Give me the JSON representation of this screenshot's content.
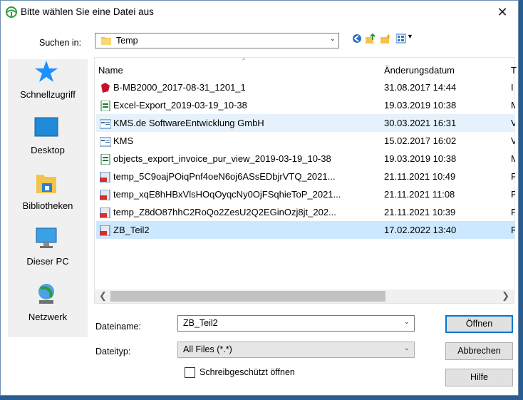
{
  "window": {
    "title": "Bitte wählen Sie eine Datei aus",
    "close_glyph": "✕"
  },
  "lookin": {
    "label": "Suchen in:",
    "value": "Temp"
  },
  "toolbar": {
    "icons": [
      "back-icon",
      "up-folder-icon",
      "new-folder-icon",
      "view-menu-icon"
    ]
  },
  "places": [
    {
      "label": "Schnellzugriff",
      "icon": "quick-access-star-icon"
    },
    {
      "label": "Desktop",
      "icon": "desktop-icon"
    },
    {
      "label": "Bibliotheken",
      "icon": "libraries-icon"
    },
    {
      "label": "Dieser PC",
      "icon": "this-pc-icon"
    },
    {
      "label": "Netzwerk",
      "icon": "network-icon"
    }
  ],
  "filelist": {
    "columns": {
      "name": "Name",
      "date": "Änderungsdatum",
      "type": "T"
    },
    "rows": [
      {
        "name": "B-MB2000_2017-08-31_1201_1",
        "date": "31.08.2017 14:44",
        "type": "I",
        "icon": "red-app-icon"
      },
      {
        "name": "Excel-Export_2019-03-19_10-38",
        "date": "19.03.2019 10:38",
        "type": "M",
        "icon": "excel-file-icon"
      },
      {
        "name": "KMS.de SoftwareEntwicklung GmbH",
        "date": "30.03.2021 16:31",
        "type": "V",
        "icon": "shortcut-file-icon"
      },
      {
        "name": "KMS",
        "date": "15.02.2017 16:02",
        "type": "V",
        "icon": "shortcut-file-icon"
      },
      {
        "name": "objects_export_invoice_pur_view_2019-03-19_10-38",
        "date": "19.03.2019 10:38",
        "type": "M",
        "icon": "excel-file-icon"
      },
      {
        "name": "temp_5C9oajPOiqPnf4oeN6oj6ASsEDbjrVTQ_2021...",
        "date": "21.11.2021 10:49",
        "type": "P",
        "icon": "pdf-file-icon"
      },
      {
        "name": "temp_xqE8hHBxVlsHOqOyqcNy0OjFSqhieToP_2021...",
        "date": "21.11.2021 11:08",
        "type": "P",
        "icon": "pdf-file-icon"
      },
      {
        "name": "temp_Z8dO87hhC2RoQo2ZesU2Q2EGinOzj8jt_202...",
        "date": "21.11.2021 10:39",
        "type": "P",
        "icon": "pdf-file-icon"
      },
      {
        "name": "ZB_Teil2",
        "date": "17.02.2022 13:40",
        "type": "P",
        "icon": "pdf-file-icon"
      }
    ],
    "hovered_row": 2,
    "selected_row": 8
  },
  "filename": {
    "label": "Dateiname:",
    "value": "ZB_Teil2"
  },
  "filetype": {
    "label": "Dateityp:",
    "value": "All Files (*.*)"
  },
  "readonly": {
    "label": "Schreibgeschützt öffnen",
    "checked": false
  },
  "buttons": {
    "open": "Öffnen",
    "cancel": "Abbrechen",
    "help": "Hilfe"
  },
  "colors": {
    "accent": "#0078d7",
    "selection": "#cce8ff",
    "hover": "#e5f1fb"
  }
}
